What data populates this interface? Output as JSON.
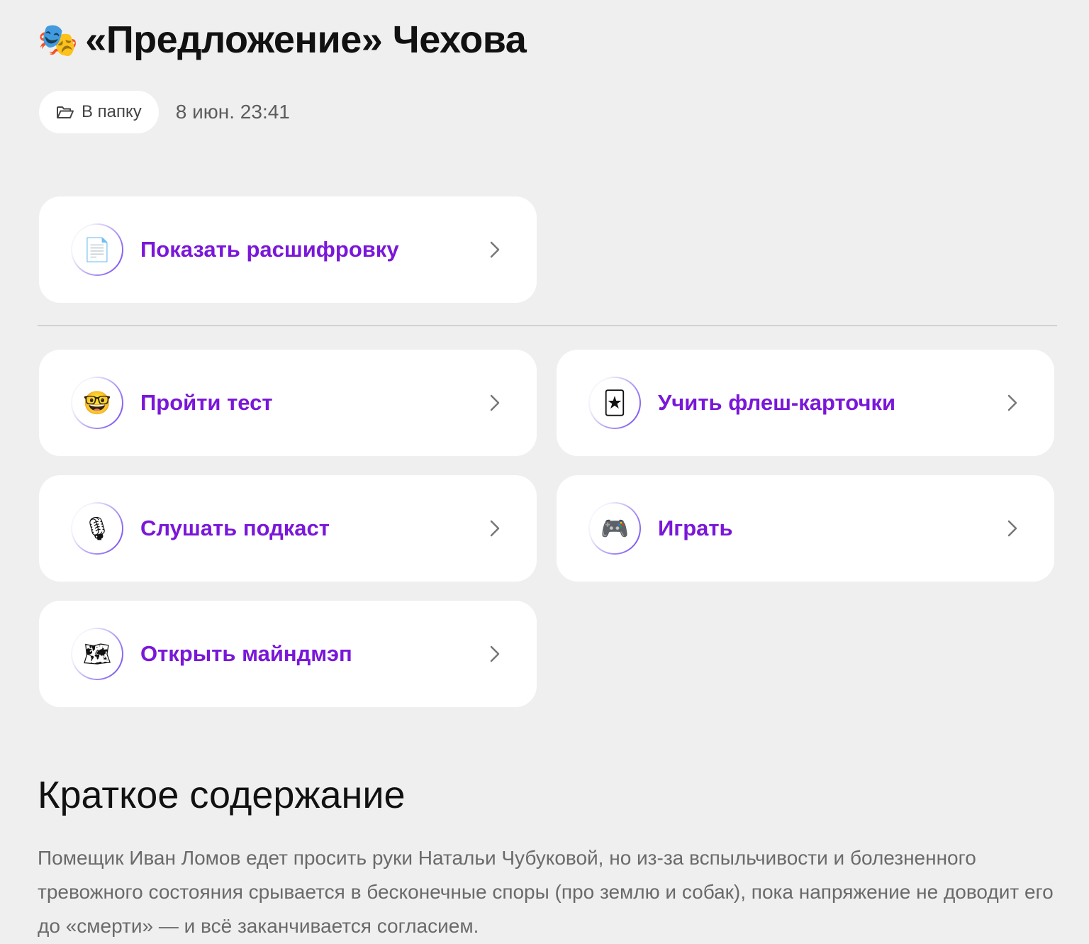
{
  "header": {
    "title_emoji": "🎭",
    "title": "«Предложение» Чехова",
    "folder_button_label": "В папку",
    "timestamp": "8 июн. 23:41"
  },
  "cards": {
    "transcript": {
      "icon": "document-icon",
      "emoji": "📄",
      "label": "Показать расшифровку"
    },
    "test": {
      "icon": "nerd-face-icon",
      "emoji": "🤓",
      "label": "Пройти тест"
    },
    "flashcards": {
      "icon": "joker-card-icon",
      "emoji": "🃏",
      "label": "Учить флеш-карточки"
    },
    "podcast": {
      "icon": "microphone-icon",
      "emoji": "🎙",
      "label": "Слушать подкаст"
    },
    "game": {
      "icon": "gamepad-icon",
      "emoji": "🎮",
      "label": "Играть"
    },
    "mindmap": {
      "icon": "map-icon",
      "emoji": "🗺",
      "label": "Открыть майндмэп"
    }
  },
  "summary_section": {
    "title": "Краткое содержание",
    "text": "Помещик Иван Ломов едет просить руки Натальи Чубуковой, но из-за вспыльчивости и болезненного тревожного состояния срывается в бесконечные споры (про землю и собак), пока напряжение не доводит его до «смерти» — и всё заканчивается согласием."
  },
  "colors": {
    "background": "#efefef",
    "card_background": "#ffffff",
    "accent_purple": "#7a17d9",
    "summary_text": "#6a6a6a"
  }
}
